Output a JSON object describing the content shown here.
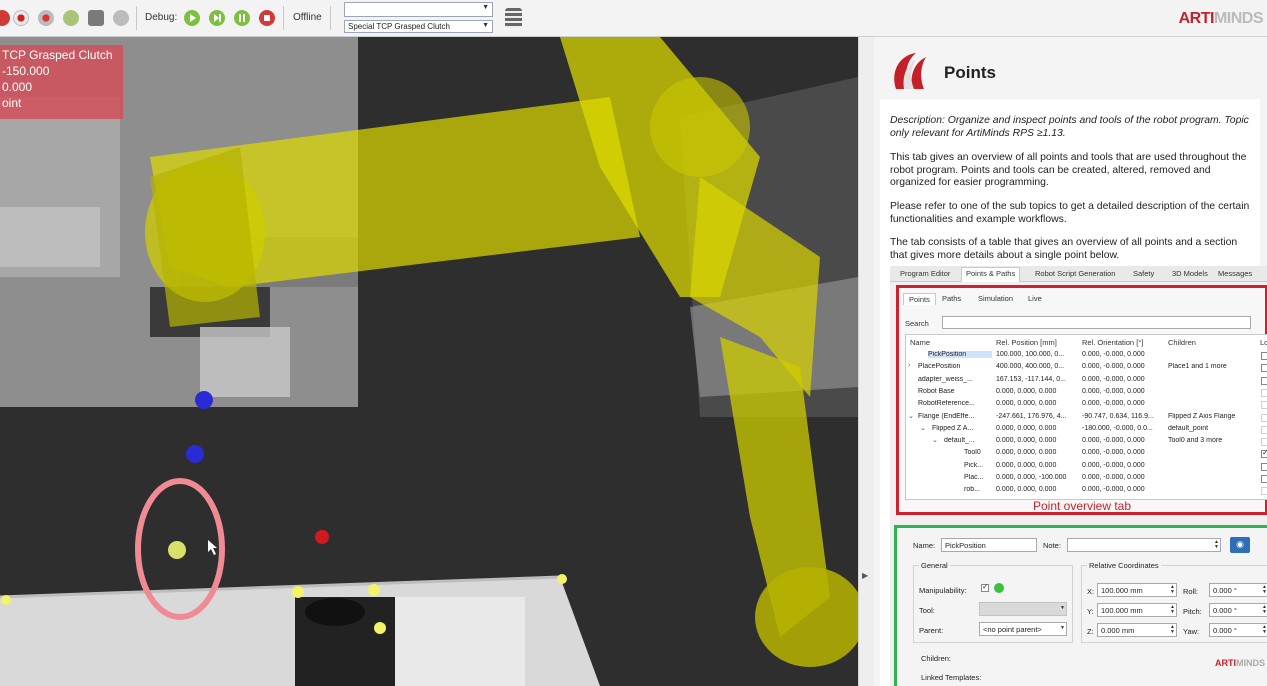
{
  "toolbar": {
    "debug_label": "Debug:",
    "status_label": "Offline",
    "combo_top_value": "",
    "combo_bottom_value": "Special TCP Grasped Clutch",
    "brand_red": "ARTI",
    "brand_gray": "MINDS"
  },
  "viewport": {
    "overlay_lines": [
      "TCP Grasped Clutch",
      "-150.000",
      "0.000",
      "oint"
    ]
  },
  "doc": {
    "title": "Points",
    "description": "Description: Organize and inspect points and tools of the robot program. Topic only relevant for ArtiMinds RPS ≥1.13.",
    "paragraphs": [
      "This tab gives an overview of all points and tools that are used throughout the robot program. Points and tools can be created, altered, removed and organized for easier programming.",
      "Please refer to one of the sub topics to get a detailed description of the certain functionalities and example workflows.",
      "The tab consists of a table that gives an overview of all points and a section that gives more details about a single point below."
    ],
    "screenshot": {
      "main_tabs": [
        "Program Editor",
        "Points & Paths",
        "Robot Script Generation",
        "Safety",
        "3D Models",
        "Messages"
      ],
      "sub_tabs": [
        "Points",
        "Paths",
        "Simulation",
        "Live"
      ],
      "search_label": "Search",
      "columns": [
        "Name",
        "Rel. Position [mm]",
        "Rel. Orientation [°]",
        "Children",
        "Lo"
      ],
      "rows": [
        {
          "expander": "",
          "name": "PickPosition",
          "pos": "100.000, 100.000, 0...",
          "ori": "0.000, -0.000, 0.000",
          "children": "",
          "check": "off"
        },
        {
          "expander": ">",
          "name": "PlacePosition",
          "pos": "400.000, 400.000, 0...",
          "ori": "0.000, -0.000, 0.000",
          "children": "Place1 and 1 more",
          "check": "off"
        },
        {
          "expander": "",
          "name": "adapter_weiss_...",
          "pos": "167.153, -117.144, 0...",
          "ori": "0.000, -0.000, 0.000",
          "children": "",
          "check": "off"
        },
        {
          "expander": "",
          "name": "Robot Base",
          "pos": "0.000, 0.000, 0.000",
          "ori": "0.000, -0.000, 0.000",
          "children": "",
          "check": "dim"
        },
        {
          "expander": "",
          "name": "RobotReference...",
          "pos": "0.000, 0.000, 0.000",
          "ori": "0.000, -0.000, 0.000",
          "children": "",
          "check": "dim"
        },
        {
          "expander": "v",
          "name": "Flange (EndEffe...",
          "pos": "-247.661, 176.976, 4...",
          "ori": "-90.747, 0.634, 116.9...",
          "children": "Flipped Z Axis Flange",
          "check": "dim"
        },
        {
          "expander": "v",
          "name": "Flipped Z A...",
          "pos": "0.000, 0.000, 0.000",
          "ori": "-180.000, -0.000, 0.0...",
          "children": "default_point",
          "check": "dim"
        },
        {
          "expander": "v",
          "name": "default_...",
          "pos": "0.000, 0.000, 0.000",
          "ori": "0.000, -0.000, 0.000",
          "children": "Tool0 and 3 more",
          "check": "dim"
        },
        {
          "expander": "",
          "name": "Tool0",
          "pos": "0.000, 0.000, 0.000",
          "ori": "0.000, -0.000, 0.000",
          "children": "",
          "check": "on"
        },
        {
          "expander": "",
          "name": "Pick...",
          "pos": "0.000, 0.000, 0.000",
          "ori": "0.000, -0.000, 0.000",
          "children": "",
          "check": "off"
        },
        {
          "expander": "",
          "name": "Plac...",
          "pos": "0.000, 0.000, -100.000",
          "ori": "0.000, -0.000, 0.000",
          "children": "",
          "check": "off"
        },
        {
          "expander": "",
          "name": "rob...",
          "pos": "0.000, 0.000, 0.000",
          "ori": "0.000, -0.000, 0.000",
          "children": "",
          "check": "dim"
        }
      ],
      "red_caption": "Point overview tab",
      "detail": {
        "name_label": "Name:",
        "name_value": "PickPosition",
        "note_label": "Note:",
        "general_label": "General",
        "manipulability_label": "Manipulability:",
        "tool_label": "Tool:",
        "parent_label": "Parent:",
        "parent_value": "<no point parent>",
        "relcoords_label": "Relative Coordinates",
        "x_label": "X:",
        "x_value": "100.000 mm",
        "y_label": "Y:",
        "y_value": "100.000 mm",
        "z_label": "Z:",
        "z_value": "0.000 mm",
        "roll_label": "Roll:",
        "roll_value": "0.000 °",
        "pitch_label": "Pitch:",
        "pitch_value": "0.000 °",
        "yaw_label": "Yaw:",
        "yaw_value": "0.000 °",
        "children_label": "Children:",
        "linked_label": "Linked Templates:"
      }
    },
    "watermark_red": "ARTI",
    "watermark_gray": "MINDS"
  },
  "colors": {
    "accent_red": "#d0202e",
    "accent_green": "#2fb34a",
    "robot_yellow": "#e5e500"
  }
}
